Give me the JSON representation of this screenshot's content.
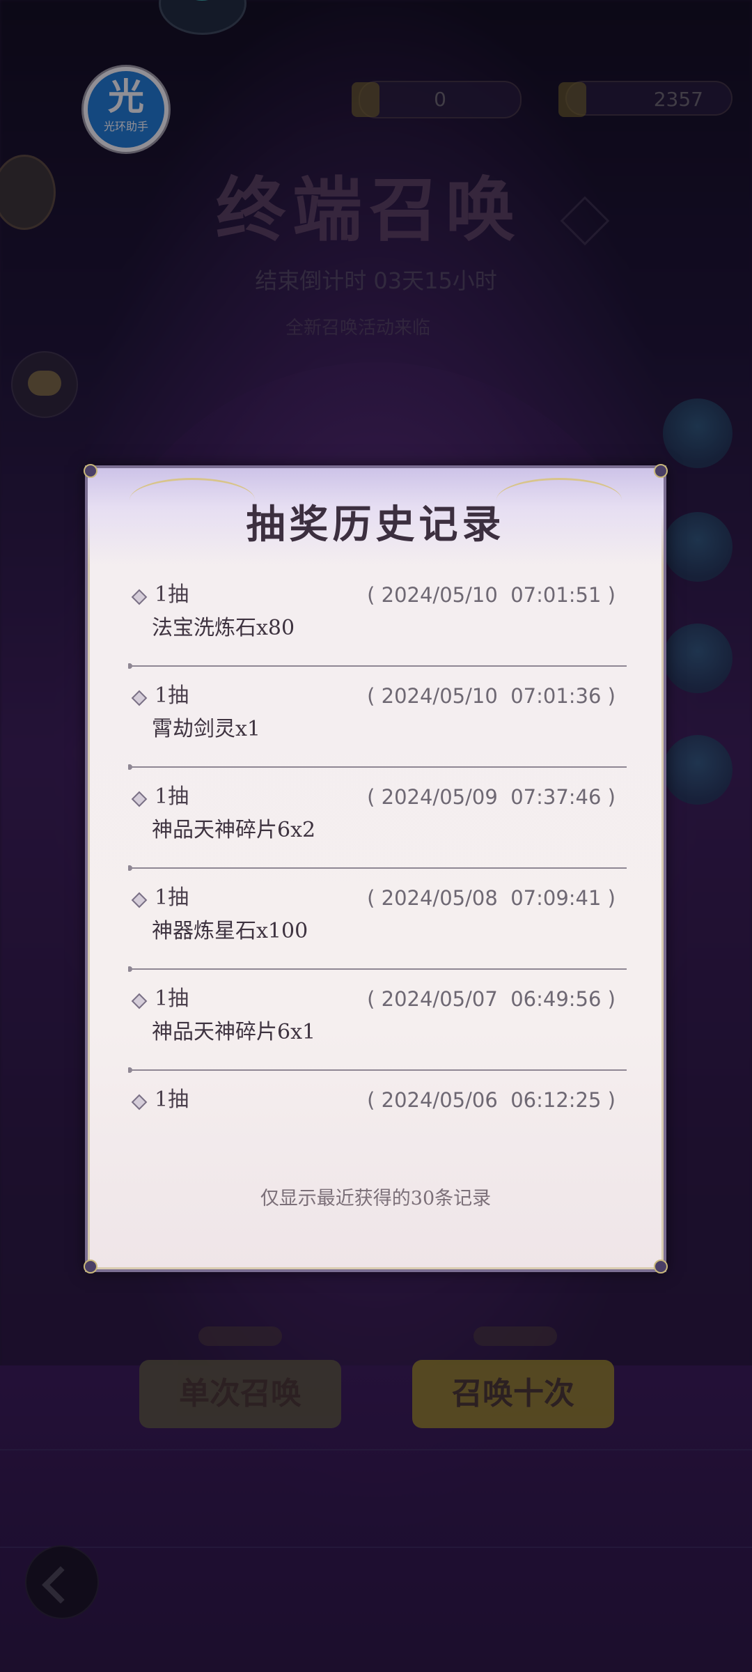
{
  "header": {
    "helper_badge_glyph": "光",
    "helper_badge_label": "光环助手",
    "resource_1_value": "0",
    "resource_2_value": "2357"
  },
  "background": {
    "title": "终端召唤",
    "countdown": "结束倒计时 03天15小时",
    "subtitle": "全新召唤活动来临",
    "single_button": "单次召唤",
    "ten_button": "召唤十次"
  },
  "modal": {
    "title": "抽奖历史记录",
    "records": [
      {
        "draws": "1抽",
        "time": "( 2024/05/10  07:01:51 )",
        "item": "法宝洗炼石x80"
      },
      {
        "draws": "1抽",
        "time": "( 2024/05/10  07:01:36 )",
        "item": "霄劫剑灵x1"
      },
      {
        "draws": "1抽",
        "time": "( 2024/05/09  07:37:46 )",
        "item": "神品天神碎片6x2"
      },
      {
        "draws": "1抽",
        "time": "( 2024/05/08  07:09:41 )",
        "item": "神器炼星石x100"
      },
      {
        "draws": "1抽",
        "time": "( 2024/05/07  06:49:56 )",
        "item": "神品天神碎片6x1"
      },
      {
        "draws": "1抽",
        "time": "( 2024/05/06  06:12:25 )",
        "item": ""
      }
    ],
    "footer_note": "仅显示最近获得的30条记录"
  }
}
